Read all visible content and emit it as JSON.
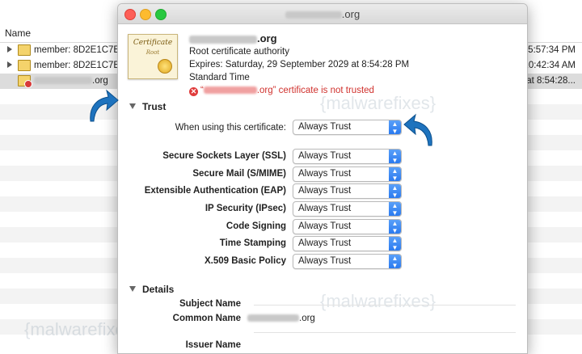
{
  "background_list": {
    "header": "Name",
    "rows": [
      {
        "name": "member: 8D2E1C7E-",
        "time": "5:57:34 PM"
      },
      {
        "name": "member: 8D2E1C7E-",
        "time": "10:42:34 AM"
      },
      {
        "name": ".org",
        "time": "at 8:54:28..."
      }
    ]
  },
  "window": {
    "title": ".org"
  },
  "certificate": {
    "icon_text": "Certificate",
    "icon_subtext": "Root",
    "common_name": ".org",
    "type": "Root certificate authority",
    "expires": "Expires: Saturday, 29 September 2029 at 8:54:28 PM",
    "timezone": "Standard Time",
    "status_prefix": "“",
    "status_name": ".org” certificate is not trusted"
  },
  "trust": {
    "section_label": "Trust",
    "when_using_label": "When using this certificate:",
    "when_using_value": "Always Trust",
    "policies": [
      {
        "label": "Secure Sockets Layer (SSL)",
        "value": "Always Trust"
      },
      {
        "label": "Secure Mail (S/MIME)",
        "value": "Always Trust"
      },
      {
        "label": "Extensible Authentication (EAP)",
        "value": "Always Trust"
      },
      {
        "label": "IP Security (IPsec)",
        "value": "Always Trust"
      },
      {
        "label": "Code Signing",
        "value": "Always Trust"
      },
      {
        "label": "Time Stamping",
        "value": "Always Trust"
      },
      {
        "label": "X.509 Basic Policy",
        "value": "Always Trust"
      }
    ]
  },
  "details": {
    "section_label": "Details",
    "subject_name_label": "Subject Name",
    "common_name_label": "Common Name",
    "common_name_value": ".org",
    "issuer_name_label": "Issuer Name"
  },
  "watermark": "{malwarefixes}",
  "colors": {
    "accent_blue": "#2a7af0",
    "error_red": "#d0312d",
    "arrow_blue": "#1e73be"
  }
}
